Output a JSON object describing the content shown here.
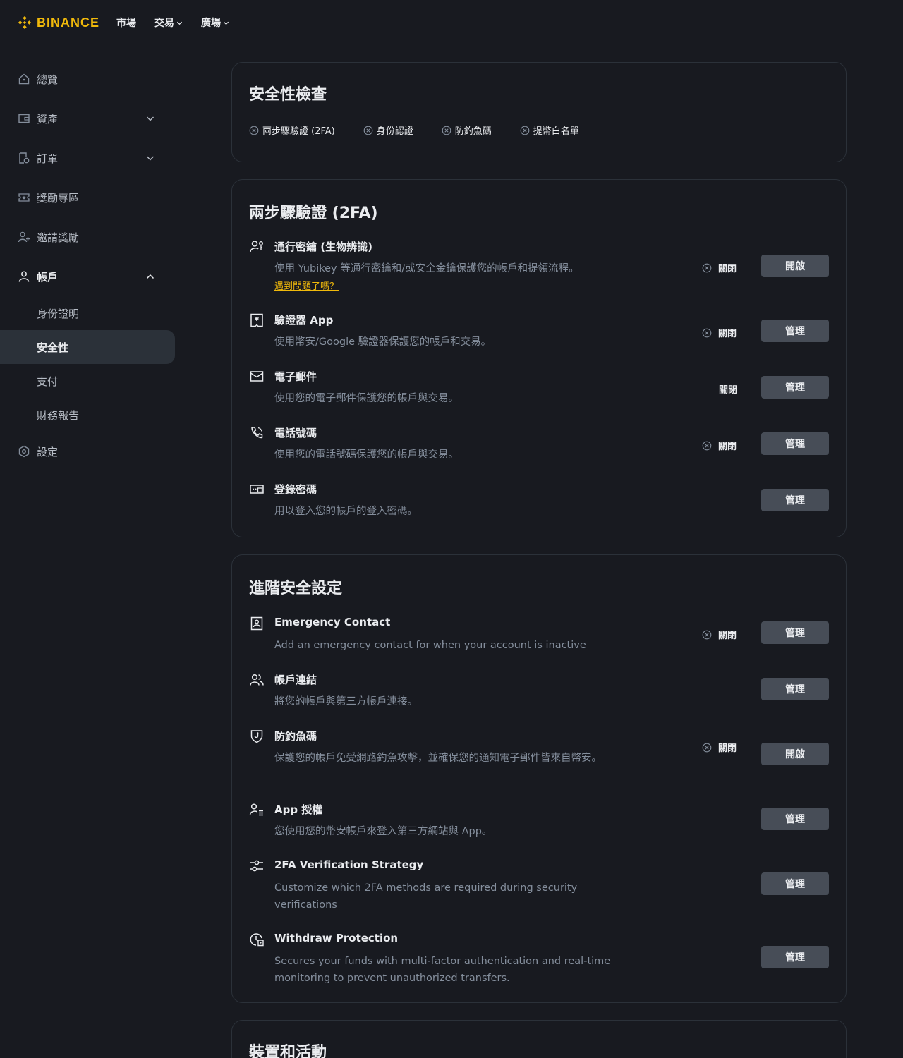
{
  "brand": {
    "name": "BINANCE",
    "color": "#f0b90b"
  },
  "nav": [
    {
      "label": "市場",
      "has_chevron": false
    },
    {
      "label": "交易",
      "has_chevron": true
    },
    {
      "label": "廣場",
      "has_chevron": true
    }
  ],
  "sidebar": {
    "overview": "總覽",
    "assets": "資產",
    "orders": "訂單",
    "rewards": "獎勵專區",
    "referral": "邀請獎勵",
    "account": "帳戶",
    "account_sub": [
      "身份證明",
      "安全性",
      "支付",
      "財務報告"
    ],
    "active_sub": "安全性",
    "settings": "設定"
  },
  "security_check": {
    "title": "安全性檢查",
    "items": [
      {
        "label": "兩步驟驗證 (2FA)",
        "icon": "x-circle-icon",
        "link": false
      },
      {
        "label": "身份認證",
        "icon": "x-circle-icon",
        "link": true
      },
      {
        "label": "防釣魚碼",
        "icon": "x-circle-icon",
        "link": true
      },
      {
        "label": "提幣白名單",
        "icon": "x-circle-icon",
        "link": true
      }
    ]
  },
  "twofa": {
    "title": "兩步驟驗證 (2FA)",
    "rows": [
      {
        "icon": "passkey-icon",
        "title": "通行密鑰 (生物辨識)",
        "desc": "使用 Yubikey 等通行密鑰和/或安全金鑰保護您的帳戶和提領流程。",
        "link": "遇到問題了嗎？",
        "status": "關閉",
        "button": "開啟"
      },
      {
        "icon": "authenticator-icon",
        "title": "驗證器 App",
        "desc": "使用幣安/Google 驗證器保護您的帳戶和交易。",
        "status": "關閉",
        "button": "管理"
      },
      {
        "icon": "mail-icon",
        "title": "電子郵件",
        "desc": "使用您的電子郵件保護您的帳戶與交易。",
        "status": "關閉",
        "button": "管理"
      },
      {
        "icon": "phone-icon",
        "title": "電話號碼",
        "desc": "使用您的電話號碼保護您的帳戶與交易。",
        "status": "關閉",
        "button": "管理"
      },
      {
        "icon": "password-icon",
        "title": "登錄密碼",
        "desc": "用以登入您的帳戶的登入密碼。",
        "button": "管理"
      }
    ]
  },
  "advanced": {
    "title": "進階安全設定",
    "rows": [
      {
        "icon": "contact-icon",
        "title": "Emergency Contact",
        "desc": "Add an emergency contact for when your account is inactive",
        "status": "關閉",
        "button": "管理"
      },
      {
        "icon": "link-accounts-icon",
        "title": "帳戶連結",
        "desc": "將您的帳戶與第三方帳戶連接。",
        "button": "管理"
      },
      {
        "icon": "anti-phishing-icon",
        "title": "防釣魚碼",
        "desc": "保護您的帳戶免受網路釣魚攻擊，並確保您的通知電子郵件皆來自幣安。",
        "status": "關閉",
        "button": "開啟"
      },
      {
        "icon": "app-auth-icon",
        "title": "App 授權",
        "desc": "您使用您的幣安帳戶來登入第三方網站與 App。",
        "button": "管理"
      },
      {
        "icon": "strategy-icon",
        "title": "2FA Verification Strategy",
        "desc": "Customize which 2FA methods are required during security verifications",
        "button": "管理"
      },
      {
        "icon": "withdraw-protect-icon",
        "title": "Withdraw Protection",
        "desc": "Secures your funds with multi-factor authentication and real-time monitoring to prevent unauthorized transfers.",
        "button": "管理"
      }
    ]
  },
  "devices": {
    "title": "裝置和活動"
  }
}
